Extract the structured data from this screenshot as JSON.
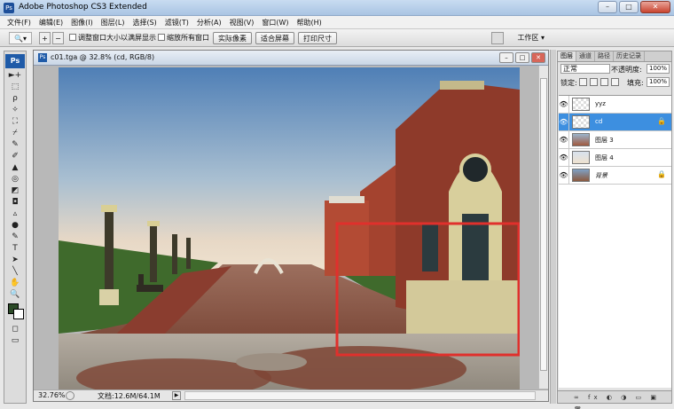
{
  "titlebar": {
    "title": "Adobe Photoshop CS3 Extended",
    "app_icon": "Ps",
    "btn_min": "–",
    "btn_max": "□",
    "btn_close": "✕"
  },
  "menus": [
    "文件(F)",
    "编辑(E)",
    "图像(I)",
    "图层(L)",
    "选择(S)",
    "滤镜(T)",
    "分析(A)",
    "视图(V)",
    "窗口(W)",
    "帮助(H)"
  ],
  "options": {
    "tool_icon": "🔍▾",
    "zoom_in": "+",
    "zoom_out": "−",
    "resize_label": "调整窗口大小以满屏显示",
    "zoom_all_label": "缩放所有窗口",
    "actual_pixels": "实际像素",
    "fit_screen": "适合屏幕",
    "print_size": "打印尺寸",
    "workspace": "工作区 ▾",
    "resize_checked": false,
    "zoom_all_checked": false
  },
  "toolbox": {
    "logo": "Ps",
    "tools": [
      "►+",
      "⬚",
      "ρ",
      "✧",
      "⛶",
      "⌿",
      "✎",
      "✐",
      "▲",
      "◎",
      "◩",
      "◘",
      "▵",
      "●",
      "✎",
      "T",
      "➤",
      "╲",
      "✋",
      "🔍"
    ],
    "tool_icons": [
      "move-icon",
      "marquee-icon",
      "lasso-icon",
      "magic-wand-icon",
      "crop-icon",
      "slice-icon",
      "healing-brush-icon",
      "brush-icon",
      "stamp-icon",
      "history-brush-icon",
      "eraser-icon",
      "gradient-icon",
      "blur-icon",
      "dodge-icon",
      "pen-icon",
      "type-icon",
      "path-select-icon",
      "line-icon",
      "hand-icon",
      "zoom-icon"
    ],
    "foreground_color": "#2b4a27",
    "background_color": "#ffffff"
  },
  "document": {
    "title": "c01.tga @ 32.8% (cd, RGB/8)",
    "zoom": "32.76%",
    "doc_size": "文档:12.6M/64.1M",
    "selection_color": "#e0302c"
  },
  "panel": {
    "tabs": [
      "图层",
      "通道",
      "路径",
      "历史记录"
    ],
    "active_tab": "图层",
    "blend_mode": "正常",
    "opacity_label": "不透明度:",
    "opacity": "100%",
    "lock_label": "锁定:",
    "fill_label": "填充:",
    "fill": "100%",
    "layers": [
      {
        "name": "yyz",
        "selected": false,
        "italic": false,
        "locked": false,
        "thumb": "checker"
      },
      {
        "name": "cd",
        "selected": true,
        "italic": false,
        "locked": true,
        "thumb": "checker"
      },
      {
        "name": "图层 3",
        "selected": false,
        "italic": false,
        "locked": false,
        "thumb": "scene"
      },
      {
        "name": "图层 4",
        "selected": false,
        "italic": false,
        "locked": false,
        "thumb": "sky"
      },
      {
        "name": "背景",
        "selected": false,
        "italic": true,
        "locked": true,
        "thumb": "scene"
      }
    ],
    "footer_icons": "∞ fx ◐ ◑ ▭ ▣ 🗑"
  }
}
